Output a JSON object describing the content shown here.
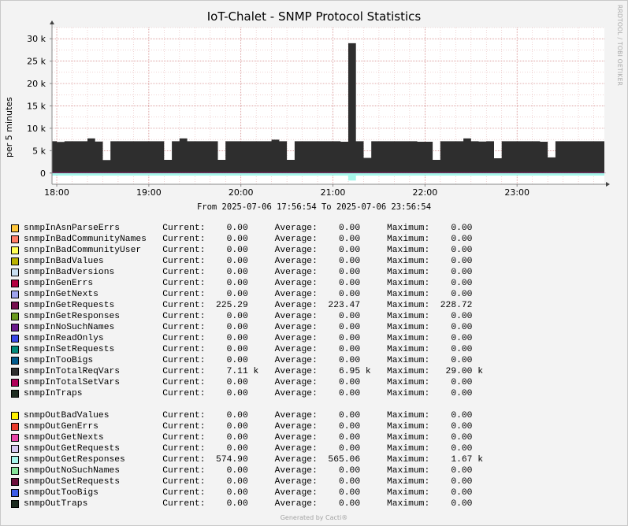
{
  "title": "IoT-Chalet - SNMP Protocol Statistics",
  "watermark": "RRDTOOL / TOBI OETIKER",
  "footer": "Generated by Cacti®",
  "date_range": "From 2025-07-06 17:56:54 To 2025-07-06 23:56:54",
  "legend_group_in": [
    {
      "name": "snmpInAsnParseErrs",
      "color": "#FFC73B",
      "current": "0.00",
      "average": "0.00",
      "maximum": "0.00"
    },
    {
      "name": "snmpInBadCommunityNames",
      "color": "#FF7D66",
      "current": "0.00",
      "average": "0.00",
      "maximum": "0.00"
    },
    {
      "name": "snnpInBadCommunityUser",
      "color": "#FFFF55",
      "current": "0.00",
      "average": "0.00",
      "maximum": "0.00"
    },
    {
      "name": "snmpInBadValues",
      "color": "#BAB100",
      "current": "0.00",
      "average": "0.00",
      "maximum": "0.00"
    },
    {
      "name": "snmpInBadVersions",
      "color": "#C8DEF0",
      "current": "0.00",
      "average": "0.00",
      "maximum": "0.00"
    },
    {
      "name": "snmpInGenErrs",
      "color": "#B40040",
      "current": "0.00",
      "average": "0.00",
      "maximum": "0.00"
    },
    {
      "name": "snmpInGetNexts",
      "color": "#9FA4EE",
      "current": "0.00",
      "average": "0.00",
      "maximum": "0.00"
    },
    {
      "name": "snmpInGetRequests",
      "color": "#750F4F",
      "current": "225.29",
      "average": "223.47",
      "maximum": "228.72"
    },
    {
      "name": "snmpInGetResponses",
      "color": "#6A9A1F",
      "current": "0.00",
      "average": "0.00",
      "maximum": "0.00"
    },
    {
      "name": "snmpInNoSuchNames",
      "color": "#6A1B8C",
      "current": "0.00",
      "average": "0.00",
      "maximum": "0.00"
    },
    {
      "name": "snmpInReadOnlys",
      "color": "#3A48E6",
      "current": "0.00",
      "average": "0.00",
      "maximum": "0.00"
    },
    {
      "name": "snmpInSetRequests",
      "color": "#00897B",
      "current": "0.00",
      "average": "0.00",
      "maximum": "0.00"
    },
    {
      "name": "snmpInTooBigs",
      "color": "#005A8C",
      "current": "0.00",
      "average": "0.00",
      "maximum": "0.00"
    },
    {
      "name": "snmpInTotalReqVars",
      "color": "#2E2E2E",
      "current": "7.11 k",
      "average": "6.95 k",
      "maximum": "29.00 k"
    },
    {
      "name": "snmpInTotalSetVars",
      "color": "#B1005A",
      "current": "0.00",
      "average": "0.00",
      "maximum": "0.00"
    },
    {
      "name": "snmpInTraps",
      "color": "#1F2E22",
      "current": "0.00",
      "average": "0.00",
      "maximum": "0.00"
    }
  ],
  "legend_group_out": [
    {
      "name": "snmpOutBadValues",
      "color": "#FFF200",
      "current": "0.00",
      "average": "0.00",
      "maximum": "0.00"
    },
    {
      "name": "snmpOutGenErrs",
      "color": "#E83A2B",
      "current": "0.00",
      "average": "0.00",
      "maximum": "0.00"
    },
    {
      "name": "snmpOutGetNexts",
      "color": "#E845A8",
      "current": "0.00",
      "average": "0.00",
      "maximum": "0.00"
    },
    {
      "name": "snmpOutGetRequests",
      "color": "#D6C8F0",
      "current": "0.00",
      "average": "0.00",
      "maximum": "0.00"
    },
    {
      "name": "snmpOutGetResponses",
      "color": "#A6F5EA",
      "current": "574.90",
      "average": "565.06",
      "maximum": "1.67 k"
    },
    {
      "name": "snmpOutNoSuchNames",
      "color": "#86E39A",
      "current": "0.00",
      "average": "0.00",
      "maximum": "0.00"
    },
    {
      "name": "snmpOutSetRequests",
      "color": "#6B0F3C",
      "current": "0.00",
      "average": "0.00",
      "maximum": "0.00"
    },
    {
      "name": "snmpOutTooBigs",
      "color": "#3B5BE6",
      "current": "0.00",
      "average": "0.00",
      "maximum": "0.00"
    },
    {
      "name": "snmpOutTraps",
      "color": "#1C2B20",
      "current": "0.00",
      "average": "0.00",
      "maximum": "0.00"
    }
  ],
  "legend_labels": {
    "current": "Current:",
    "average": "Average:",
    "maximum": "Maximum:"
  },
  "chart_data": {
    "type": "area",
    "title": "IoT-Chalet - SNMP Protocol Statistics",
    "ylabel": "per 5 minutes",
    "xlabel": "",
    "ylim": [
      -2500,
      32500
    ],
    "xlim": [
      "17:56:54",
      "23:56:54"
    ],
    "grid": true,
    "yticks": [
      0,
      5000,
      10000,
      15000,
      20000,
      25000,
      30000
    ],
    "ytick_labels": [
      "0",
      "5 k",
      "10 k",
      "15 k",
      "20 k",
      "25 k",
      "30 k"
    ],
    "xtick_labels": [
      "18:00",
      "19:00",
      "20:00",
      "21:00",
      "22:00",
      "23:00"
    ],
    "series": [
      {
        "name": "snmpInTotalReqVars",
        "color": "#2E2E2E",
        "points": [
          [
            "17:56:54",
            7100
          ],
          [
            "18:00",
            6950
          ],
          [
            "18:05",
            7100
          ],
          [
            "18:10",
            7100
          ],
          [
            "18:15",
            7100
          ],
          [
            "18:20",
            7750
          ],
          [
            "18:25",
            7050
          ],
          [
            "18:30",
            2900
          ],
          [
            "18:35",
            7100
          ],
          [
            "18:40",
            7100
          ],
          [
            "18:45",
            7100
          ],
          [
            "18:50",
            7100
          ],
          [
            "18:55",
            7100
          ],
          [
            "19:00",
            7100
          ],
          [
            "19:05",
            7100
          ],
          [
            "19:10",
            2950
          ],
          [
            "19:15",
            7100
          ],
          [
            "19:20",
            7750
          ],
          [
            "19:25",
            7100
          ],
          [
            "19:30",
            7100
          ],
          [
            "19:35",
            7100
          ],
          [
            "19:40",
            7100
          ],
          [
            "19:45",
            2950
          ],
          [
            "19:50",
            7100
          ],
          [
            "19:55",
            7100
          ],
          [
            "20:00",
            7100
          ],
          [
            "20:05",
            7100
          ],
          [
            "20:10",
            7100
          ],
          [
            "20:15",
            7100
          ],
          [
            "20:20",
            7450
          ],
          [
            "20:25",
            7100
          ],
          [
            "20:30",
            2950
          ],
          [
            "20:35",
            7100
          ],
          [
            "20:40",
            7100
          ],
          [
            "20:45",
            7100
          ],
          [
            "20:50",
            7100
          ],
          [
            "20:55",
            7100
          ],
          [
            "21:00",
            7100
          ],
          [
            "21:05",
            7000
          ],
          [
            "21:10",
            29000
          ],
          [
            "21:15",
            7100
          ],
          [
            "21:20",
            3400
          ],
          [
            "21:25",
            7100
          ],
          [
            "21:30",
            7100
          ],
          [
            "21:35",
            7100
          ],
          [
            "21:40",
            7100
          ],
          [
            "21:45",
            7100
          ],
          [
            "21:50",
            7100
          ],
          [
            "21:55",
            7000
          ],
          [
            "22:00",
            7000
          ],
          [
            "22:05",
            2950
          ],
          [
            "22:10",
            7100
          ],
          [
            "22:15",
            7100
          ],
          [
            "22:20",
            7100
          ],
          [
            "22:25",
            7750
          ],
          [
            "22:30",
            7100
          ],
          [
            "22:35",
            7050
          ],
          [
            "22:40",
            7100
          ],
          [
            "22:45",
            3300
          ],
          [
            "22:50",
            7100
          ],
          [
            "22:55",
            7100
          ],
          [
            "23:00",
            7100
          ],
          [
            "23:05",
            7100
          ],
          [
            "23:10",
            7100
          ],
          [
            "23:15",
            7000
          ],
          [
            "23:20",
            3500
          ],
          [
            "23:25",
            7100
          ],
          [
            "23:30",
            7100
          ],
          [
            "23:35",
            7100
          ],
          [
            "23:40",
            7100
          ],
          [
            "23:45",
            7100
          ],
          [
            "23:50",
            7100
          ],
          [
            "23:56:54",
            7110
          ]
        ]
      },
      {
        "name": "snmpInGetRequests",
        "color": "#750F4F",
        "points": [
          [
            "17:56:54",
            225
          ],
          [
            "23:56:54",
            225
          ]
        ]
      },
      {
        "name": "snmpOutGetResponses",
        "color": "#A6F5EA",
        "points": [
          [
            "17:56:54",
            -560
          ],
          [
            "21:05",
            -560
          ],
          [
            "21:10",
            -1670
          ],
          [
            "21:15",
            -560
          ],
          [
            "23:56:54",
            -575
          ]
        ]
      }
    ]
  }
}
